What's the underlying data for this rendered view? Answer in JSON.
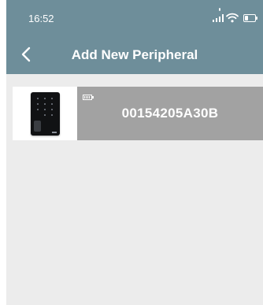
{
  "status_bar": {
    "time": "16:52"
  },
  "header": {
    "title": "Add New Peripheral",
    "back_icon": "chevron-left-icon"
  },
  "devices": [
    {
      "id": "00154205A30B",
      "image": "keypad-reader-image",
      "battery_icon": "battery-icon"
    }
  ],
  "colors": {
    "header_bg": "#6e8e9a",
    "card_bg": "#a2a2a2",
    "screen_bg": "#ececec",
    "status_dot": "#f0a020"
  }
}
